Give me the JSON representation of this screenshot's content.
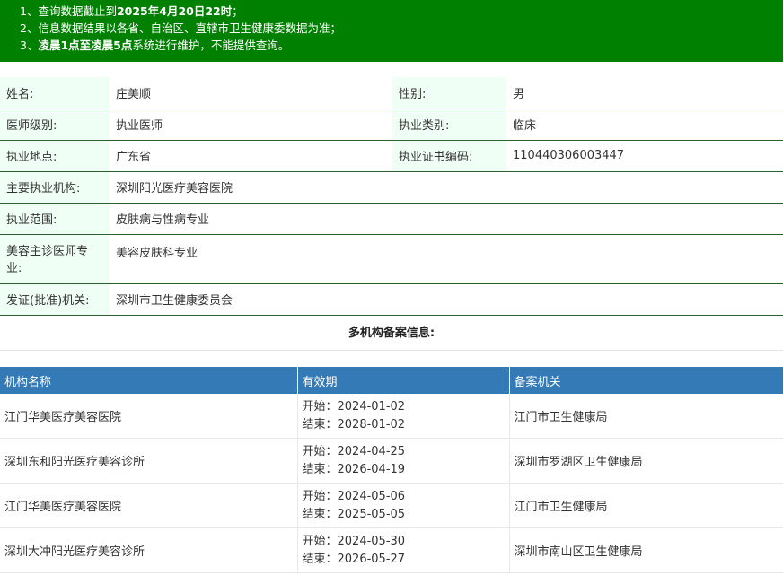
{
  "notice": {
    "line1_prefix": "1、查询数据截止到",
    "line1_bold": "2025年4月20日22时",
    "line1_suffix": "；",
    "line2": "2、信息数据结果以各省、自治区、直辖市卫生健康委数据为准；",
    "line3_prefix": "3、",
    "line3_bold": "凌晨1点至凌晨5点",
    "line3_suffix": "系统进行维护，不能提供查询。"
  },
  "info": {
    "name_label": "姓名:",
    "name_value": "庄美顺",
    "gender_label": "性别:",
    "gender_value": "男",
    "level_label": "医师级别:",
    "level_value": "执业医师",
    "category_label": "执业类别:",
    "category_value": "临床",
    "location_label": "执业地点:",
    "location_value": "广东省",
    "cert_label": "执业证书编码:",
    "cert_value": "110440306003447",
    "org_label": "主要执业机构:",
    "org_value": "深圳阳光医疗美容医院",
    "scope_label": "执业范围:",
    "scope_value": "皮肤病与性病专业",
    "cosmetic_label": "美容主诊医师专业:",
    "cosmetic_value": "美容皮肤科专业",
    "issuer_label": "发证(批准)机关:",
    "issuer_value": "深圳市卫生健康委员会"
  },
  "multi_title": "多机构备案信息:",
  "records": {
    "headers": [
      "机构名称",
      "有效期",
      "备案机关"
    ],
    "rows": [
      {
        "name": "江门华美医疗美容医院",
        "start": "开始：2024-01-02",
        "end": "结束：2028-01-02",
        "agency": "江门市卫生健康局"
      },
      {
        "name": "深圳东和阳光医疗美容诊所",
        "start": "开始：2024-04-25",
        "end": "结束：2026-04-19",
        "agency": "深圳市罗湖区卫生健康局"
      },
      {
        "name": "江门华美医疗美容医院",
        "start": "开始：2024-05-06",
        "end": "结束：2025-05-05",
        "agency": "江门市卫生健康局"
      },
      {
        "name": "深圳大冲阳光医疗美容诊所",
        "start": "开始：2024-05-30",
        "end": "结束：2026-05-27",
        "agency": "深圳市南山区卫生健康局"
      }
    ]
  },
  "colors": {
    "notice_bg": "#008000",
    "header_bg": "#337ab7",
    "label_bg": "#f0fff5"
  }
}
